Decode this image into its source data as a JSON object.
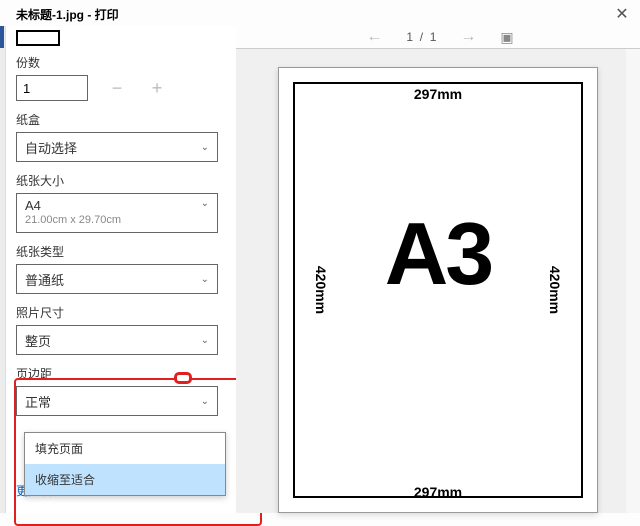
{
  "window": {
    "title": "未标题-1.jpg - 打印"
  },
  "pager": {
    "current": "1",
    "sep": "/",
    "total": "1"
  },
  "copies": {
    "label": "份数",
    "value": "1"
  },
  "tray": {
    "label": "纸盒",
    "value": "自动选择"
  },
  "size": {
    "label": "纸张大小",
    "value": "A4",
    "sub": "21.00cm x 29.70cm"
  },
  "type": {
    "label": "纸张类型",
    "value": "普通纸"
  },
  "photo": {
    "label": "照片尺寸",
    "value": "整页"
  },
  "margin": {
    "label": "页边距",
    "value": "正常"
  },
  "scale_options": {
    "fill": "填充页面",
    "fit": "收缩至适合"
  },
  "more": "更多设置",
  "preview": {
    "width_label": "297mm",
    "height_label": "420mm",
    "content": "A3"
  }
}
